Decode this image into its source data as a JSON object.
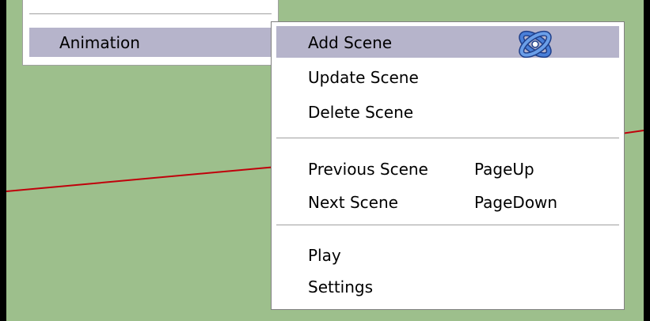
{
  "colors": {
    "viewport_background": "#9dbf8c",
    "frame": "#000000",
    "menu_background": "#ffffff",
    "highlight": "#b6b4cb",
    "horizon_line": "#c0000b",
    "cursor_blue": "#4a7fd8"
  },
  "parent_menu": {
    "item_label": "Animation",
    "item_icon": "chevron-right-icon"
  },
  "submenu": {
    "items": [
      {
        "label": "Add Scene",
        "shortcut": "",
        "highlighted": true
      },
      {
        "label": "Update Scene",
        "shortcut": ""
      },
      {
        "label": "Delete Scene",
        "shortcut": ""
      },
      {
        "label": "Previous Scene",
        "shortcut": "PageUp"
      },
      {
        "label": "Next Scene",
        "shortcut": "PageDown"
      },
      {
        "label": "Play",
        "shortcut": ""
      },
      {
        "label": "Settings",
        "shortcut": ""
      }
    ]
  },
  "cursor": {
    "icon": "orbit-tool-icon"
  }
}
